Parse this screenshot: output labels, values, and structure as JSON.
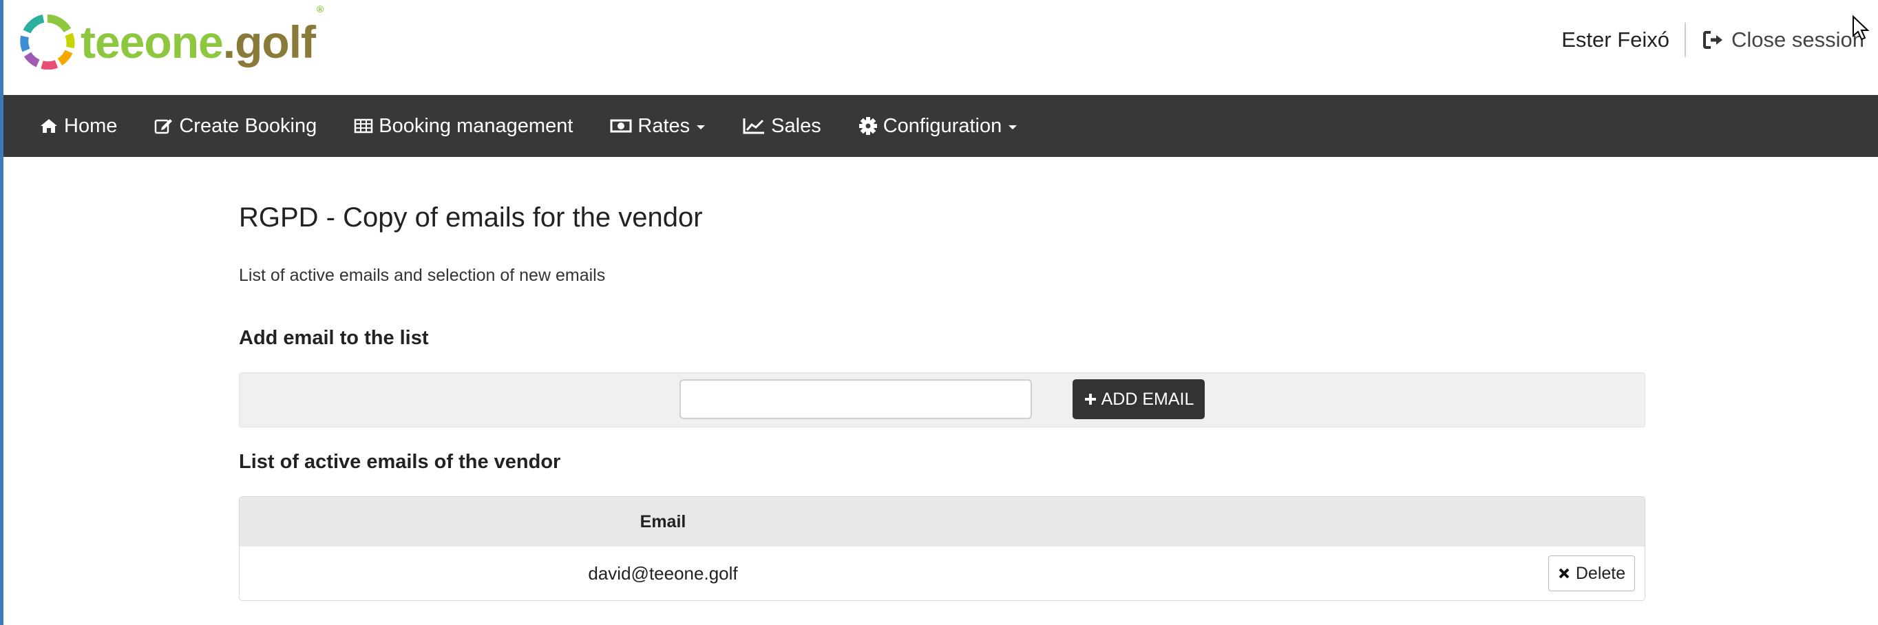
{
  "brand": {
    "name_main": "teeone",
    "name_suffix": ".golf",
    "registered_mark": "®",
    "colors": {
      "green": "#8dc63f",
      "olive": "#8a7a3a"
    }
  },
  "header": {
    "user_name": "Ester Feixó",
    "close_session_label": "Close session",
    "close_session_icon": "sign-out-icon"
  },
  "nav": {
    "background": "#383838",
    "items": [
      {
        "label": "Home",
        "icon": "home-icon",
        "dropdown": false
      },
      {
        "label": "Create Booking",
        "icon": "edit-icon",
        "dropdown": false
      },
      {
        "label": "Booking management",
        "icon": "table-icon",
        "dropdown": false
      },
      {
        "label": "Rates",
        "icon": "money-icon",
        "dropdown": true
      },
      {
        "label": "Sales",
        "icon": "line-chart-icon",
        "dropdown": false
      },
      {
        "label": "Configuration",
        "icon": "gear-icon",
        "dropdown": true
      }
    ]
  },
  "page": {
    "title": "RGPD - Copy of emails for the vendor",
    "subtitle": "List of active emails and selection of new emails"
  },
  "add_section": {
    "title": "Add email to the list",
    "input_value": "",
    "input_placeholder": "",
    "button_label": "ADD EMAIL"
  },
  "list_section": {
    "title": "List of active emails of the vendor",
    "column_header": "Email",
    "rows": [
      {
        "email": "david@teeone.golf",
        "action_label": "Delete"
      }
    ]
  }
}
